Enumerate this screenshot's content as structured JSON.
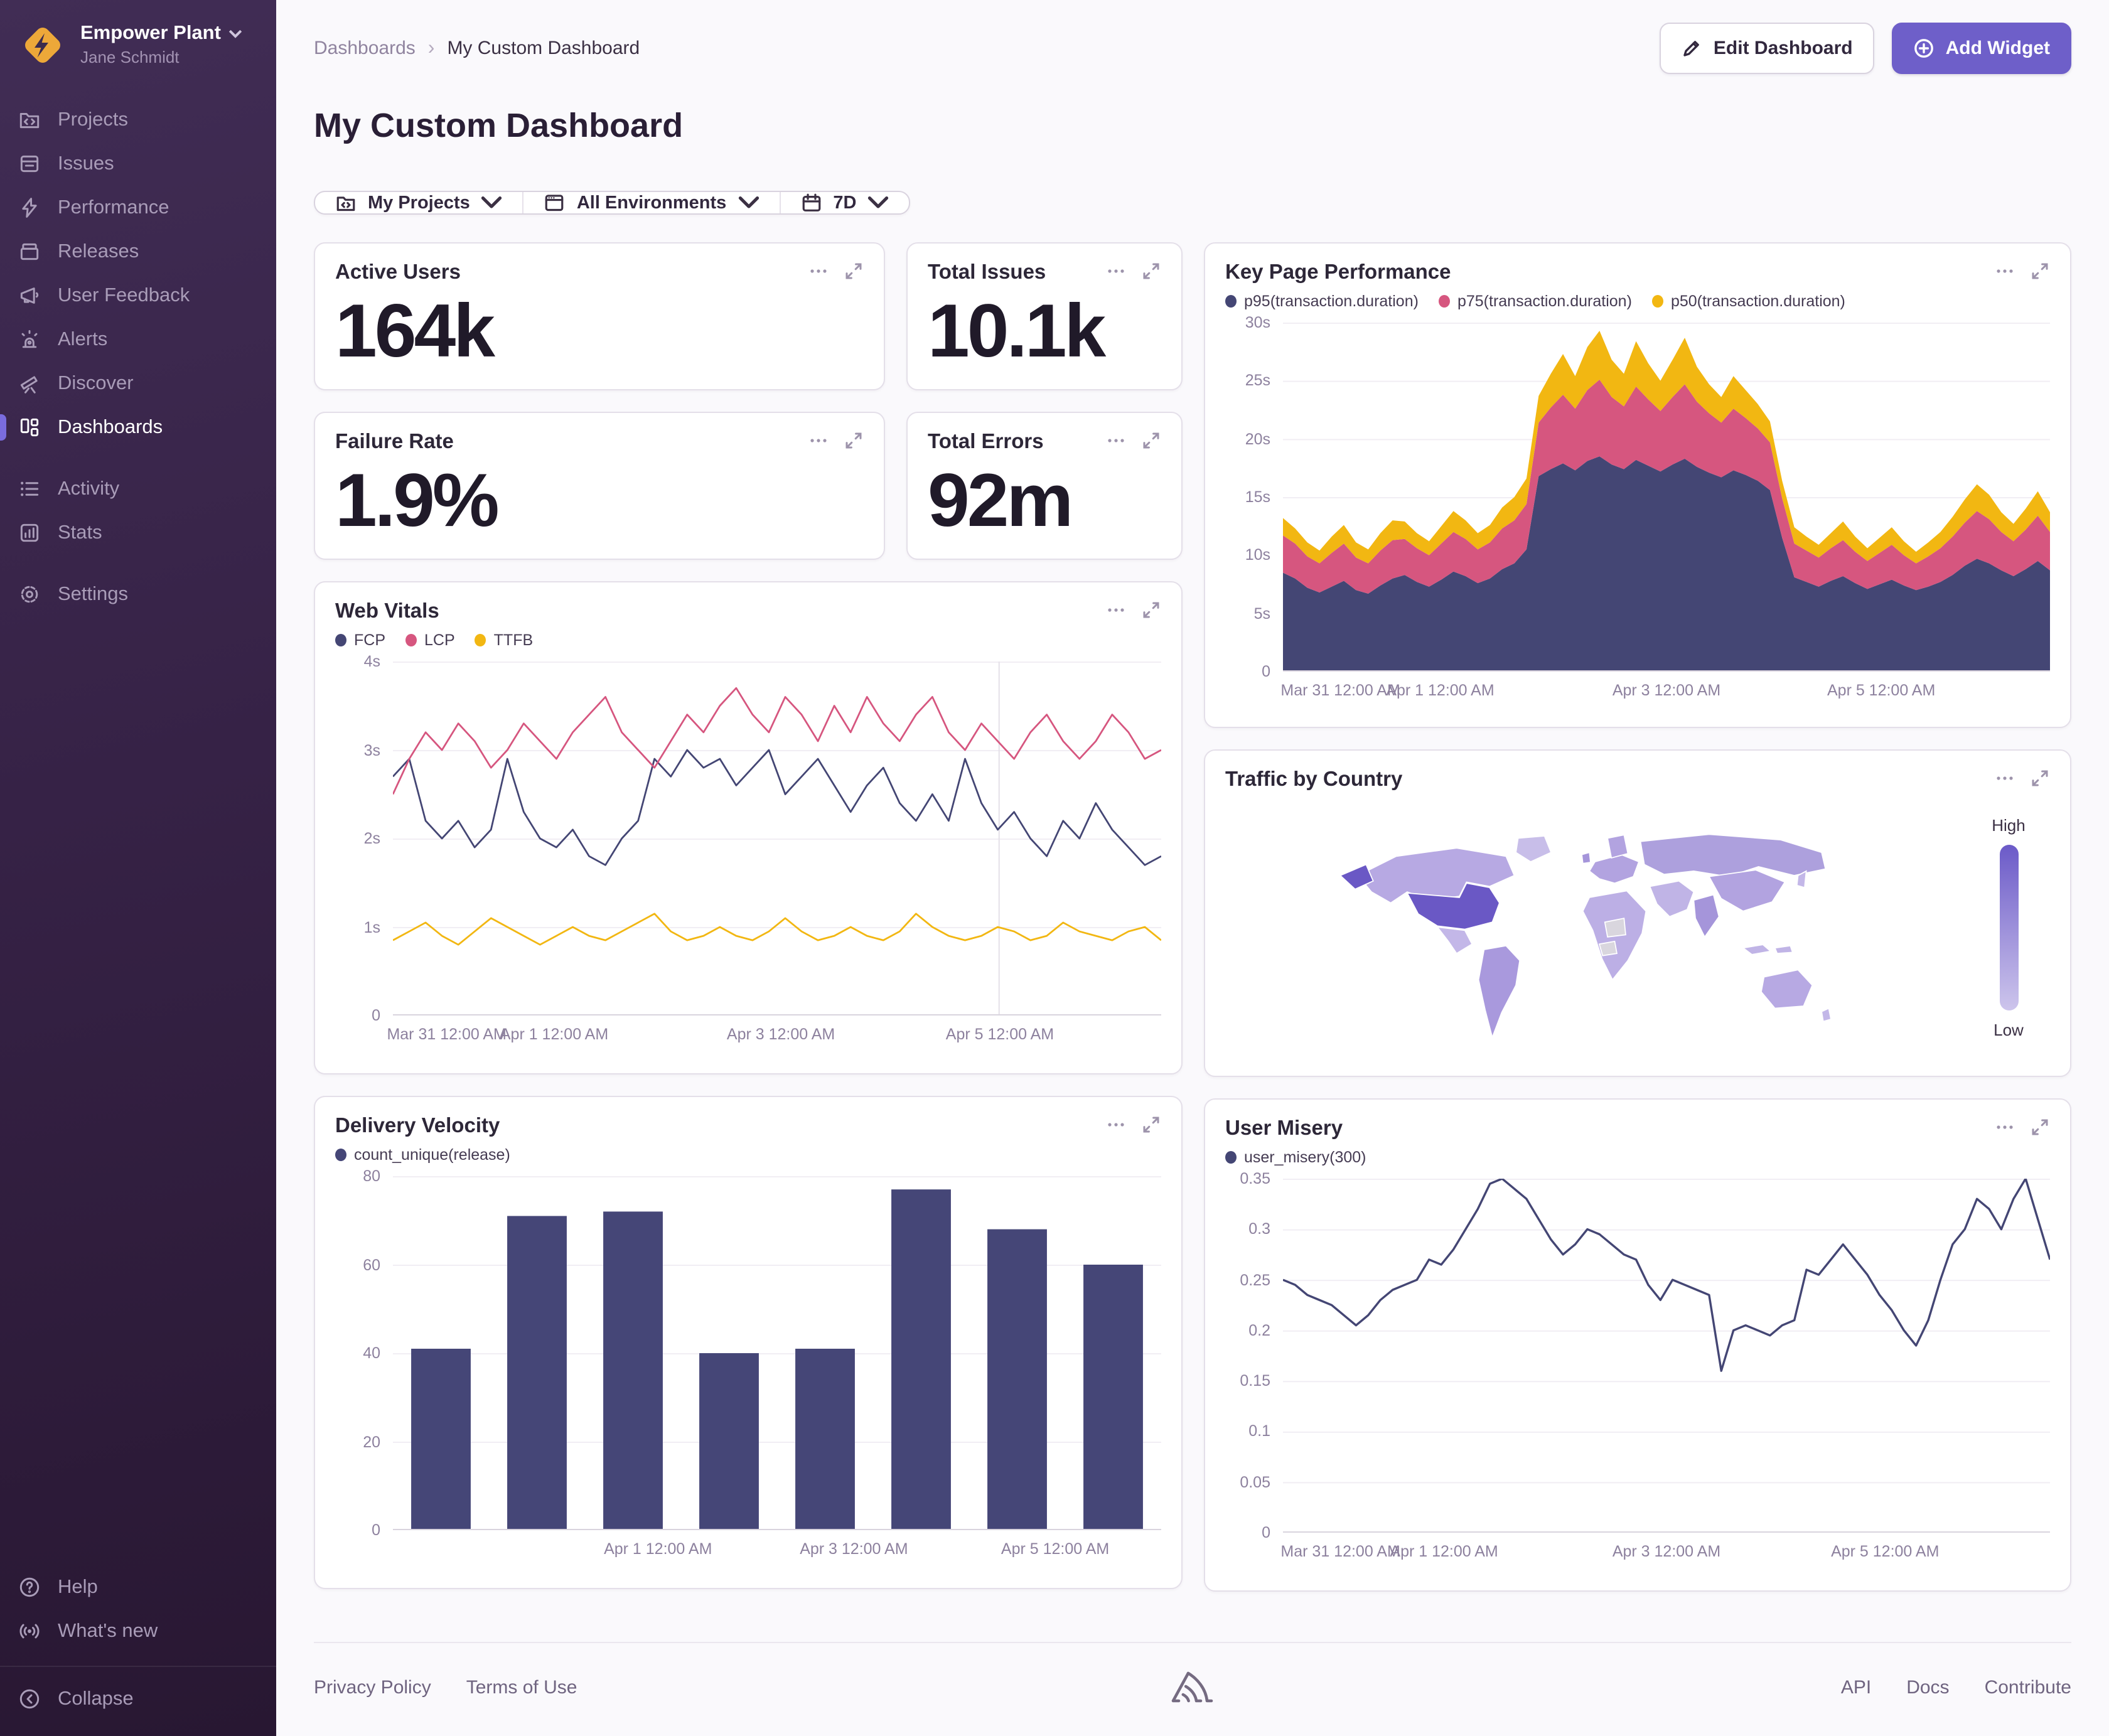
{
  "sidebar": {
    "org": {
      "name": "Empower Plant",
      "user": "Jane Schmidt"
    },
    "items": [
      {
        "label": "Projects"
      },
      {
        "label": "Issues"
      },
      {
        "label": "Performance"
      },
      {
        "label": "Releases"
      },
      {
        "label": "User Feedback"
      },
      {
        "label": "Alerts"
      },
      {
        "label": "Discover"
      },
      {
        "label": "Dashboards"
      },
      {
        "label": "Activity"
      },
      {
        "label": "Stats"
      },
      {
        "label": "Settings"
      }
    ],
    "active_item": "Dashboards",
    "bottom_items": [
      {
        "label": "Help"
      },
      {
        "label": "What's new"
      },
      {
        "label": "Collapse"
      }
    ]
  },
  "header": {
    "breadcrumb": {
      "parent": "Dashboards",
      "current": "My Custom Dashboard"
    },
    "title": "My Custom Dashboard",
    "edit_button": "Edit Dashboard",
    "add_button": "Add Widget"
  },
  "filters": {
    "projects": "My Projects",
    "environments": "All Environments",
    "date_range": "7D"
  },
  "big_numbers": [
    {
      "title": "Active Users",
      "value": "164k"
    },
    {
      "title": "Total Issues",
      "value": "10.1k"
    },
    {
      "title": "Failure Rate",
      "value": "1.9%"
    },
    {
      "title": "Total Errors",
      "value": "92m"
    }
  ],
  "map_widget": {
    "title": "Traffic by Country",
    "legend_high": "High",
    "legend_low": "Low",
    "note": "Choropleth world map; United States shaded darkest (high traffic), other countries light purple, a few countries gray (no data)"
  },
  "colors": {
    "accent": "#6e5fc9",
    "navy": "#444674",
    "pink": "#d6567f",
    "yellow": "#f2b712",
    "sidebar_active_indicator": "#7a6cde"
  },
  "footer": {
    "left": [
      "Privacy Policy",
      "Terms of Use"
    ],
    "right": [
      "API",
      "Docs",
      "Contribute"
    ]
  },
  "chart_data": [
    {
      "type": "area",
      "stacked": true,
      "title": "Key Page Performance",
      "ymax": 30,
      "yticks": [
        "0",
        "5s",
        "10s",
        "15s",
        "20s",
        "25s",
        "30s"
      ],
      "xticks": [
        {
          "label": "Mar 31 12:00 AM",
          "pos": 0.075
        },
        {
          "label": "Apr 1 12:00 AM",
          "pos": 0.205
        },
        {
          "label": "Apr 3 12:00 AM",
          "pos": 0.5
        },
        {
          "label": "Apr 5 12:00 AM",
          "pos": 0.78
        }
      ],
      "series": [
        {
          "name": "p95(transaction.duration)",
          "color": "#444674",
          "values": [
            8.5,
            8.0,
            7.2,
            6.8,
            7.3,
            7.8,
            7.0,
            6.7,
            7.4,
            8.0,
            8.3,
            7.7,
            7.3,
            7.9,
            8.6,
            8.2,
            7.6,
            8.0,
            8.8,
            9.3,
            10.5,
            16.8,
            17.4,
            17.9,
            17.3,
            18.1,
            18.5,
            17.8,
            17.4,
            18.2,
            17.7,
            17.2,
            17.8,
            18.3,
            17.6,
            17.1,
            16.7,
            17.3,
            16.9,
            16.4,
            15.6,
            11.5,
            8.1,
            7.7,
            7.3,
            7.8,
            8.2,
            7.6,
            7.1,
            7.5,
            7.9,
            7.4,
            7.0,
            7.3,
            7.7,
            8.3,
            9.1,
            9.7,
            9.3,
            8.7,
            8.2,
            8.8,
            9.5,
            8.7
          ]
        },
        {
          "name": "p75(transaction.duration)",
          "color": "#d6567f",
          "values": [
            3.2,
            3.0,
            2.7,
            2.5,
            2.9,
            3.2,
            2.8,
            2.6,
            3.0,
            3.3,
            3.1,
            2.9,
            2.7,
            3.1,
            3.4,
            3.2,
            2.9,
            3.1,
            3.5,
            3.7,
            3.9,
            4.6,
            5.3,
            5.9,
            5.3,
            6.1,
            6.6,
            5.8,
            5.4,
            6.3,
            5.7,
            5.2,
            5.8,
            6.4,
            5.6,
            5.1,
            4.7,
            5.3,
            4.9,
            4.5,
            4.1,
            3.4,
            2.9,
            2.7,
            2.5,
            2.8,
            3.1,
            2.7,
            2.4,
            2.7,
            3.0,
            2.6,
            2.3,
            2.6,
            2.9,
            3.3,
            3.7,
            4.1,
            3.8,
            3.3,
            3.0,
            3.4,
            3.9,
            3.3
          ]
        },
        {
          "name": "p50(transaction.duration)",
          "color": "#f2b712",
          "values": [
            1.5,
            1.3,
            1.2,
            1.1,
            1.4,
            1.6,
            1.3,
            1.2,
            1.5,
            1.7,
            1.5,
            1.3,
            1.2,
            1.5,
            1.8,
            1.6,
            1.4,
            1.5,
            1.8,
            2.0,
            2.2,
            2.3,
            2.9,
            3.5,
            2.8,
            3.7,
            4.2,
            3.2,
            2.8,
            3.9,
            3.1,
            2.6,
            3.2,
            4.0,
            3.0,
            2.5,
            2.2,
            2.8,
            2.4,
            2.1,
            1.8,
            1.5,
            1.4,
            1.2,
            1.1,
            1.3,
            1.6,
            1.3,
            1.1,
            1.3,
            1.5,
            1.2,
            1.0,
            1.2,
            1.4,
            1.7,
            2.0,
            2.3,
            2.1,
            1.7,
            1.5,
            1.8,
            2.1,
            1.7
          ]
        }
      ]
    },
    {
      "type": "line",
      "title": "Web Vitals",
      "ymax": 4,
      "yticks": [
        "0",
        "1s",
        "2s",
        "3s",
        "4s"
      ],
      "vline": 0.789,
      "xticks": [
        {
          "label": "Mar 31 12:00 AM",
          "pos": 0.07
        },
        {
          "label": "Apr 1 12:00 AM",
          "pos": 0.21
        },
        {
          "label": "Apr 3 12:00 AM",
          "pos": 0.505
        },
        {
          "label": "Apr 5 12:00 AM",
          "pos": 0.79
        }
      ],
      "series": [
        {
          "name": "FCP",
          "color": "#444674",
          "values": [
            2.7,
            2.9,
            2.2,
            2.0,
            2.2,
            1.9,
            2.1,
            2.9,
            2.3,
            2.0,
            1.9,
            2.1,
            1.8,
            1.7,
            2.0,
            2.2,
            2.9,
            2.7,
            3.0,
            2.8,
            2.9,
            2.6,
            2.8,
            3.0,
            2.5,
            2.7,
            2.9,
            2.6,
            2.3,
            2.6,
            2.8,
            2.4,
            2.2,
            2.5,
            2.2,
            2.9,
            2.4,
            2.1,
            2.3,
            2.0,
            1.8,
            2.2,
            2.0,
            2.4,
            2.1,
            1.9,
            1.7,
            1.8
          ]
        },
        {
          "name": "LCP",
          "color": "#d6567f",
          "values": [
            2.5,
            2.9,
            3.2,
            3.0,
            3.3,
            3.1,
            2.8,
            3.0,
            3.3,
            3.1,
            2.9,
            3.2,
            3.4,
            3.6,
            3.2,
            3.0,
            2.8,
            3.1,
            3.4,
            3.2,
            3.5,
            3.7,
            3.4,
            3.2,
            3.6,
            3.4,
            3.1,
            3.5,
            3.2,
            3.6,
            3.3,
            3.1,
            3.4,
            3.6,
            3.2,
            3.0,
            3.3,
            3.1,
            2.9,
            3.2,
            3.4,
            3.1,
            2.9,
            3.1,
            3.4,
            3.2,
            2.9,
            3.0
          ]
        },
        {
          "name": "TTFB",
          "color": "#f2b712",
          "values": [
            0.85,
            0.95,
            1.05,
            0.9,
            0.8,
            0.95,
            1.1,
            1.0,
            0.9,
            0.8,
            0.9,
            1.0,
            0.9,
            0.85,
            0.95,
            1.05,
            1.15,
            0.95,
            0.85,
            0.9,
            1.0,
            0.9,
            0.85,
            0.95,
            1.1,
            0.95,
            0.85,
            0.9,
            1.0,
            0.9,
            0.85,
            0.95,
            1.15,
            1.0,
            0.9,
            0.85,
            0.9,
            1.0,
            0.95,
            0.85,
            0.9,
            1.05,
            0.95,
            0.9,
            0.85,
            0.95,
            1.0,
            0.85
          ]
        }
      ]
    },
    {
      "type": "bar",
      "title": "Delivery Velocity",
      "ymax": 80,
      "yticks": [
        "0",
        "20",
        "40",
        "60",
        "80"
      ],
      "xticks": [
        {
          "label": "Apr 1 12:00 AM",
          "pos": 0.345
        },
        {
          "label": "Apr 3 12:00 AM",
          "pos": 0.6
        },
        {
          "label": "Apr 5 12:00 AM",
          "pos": 0.862
        }
      ],
      "series": [
        {
          "name": "count_unique(release)",
          "color": "#454677",
          "values": [
            41,
            71,
            72,
            40,
            41,
            77,
            68,
            60
          ]
        }
      ]
    },
    {
      "type": "line",
      "title": "User Misery",
      "ymax": 0.35,
      "lw": 1.7,
      "yticks": [
        "0",
        "0.05",
        "0.1",
        "0.15",
        "0.2",
        "0.25",
        "0.3",
        "0.35"
      ],
      "xticks": [
        {
          "label": "Mar 31 12:00 AM",
          "pos": 0.075
        },
        {
          "label": "Apr 1 12:00 AM",
          "pos": 0.21
        },
        {
          "label": "Apr 3 12:00 AM",
          "pos": 0.5
        },
        {
          "label": "Apr 5 12:00 AM",
          "pos": 0.785
        }
      ],
      "series": [
        {
          "name": "user_misery(300)",
          "color": "#444674",
          "values": [
            0.25,
            0.245,
            0.235,
            0.23,
            0.225,
            0.215,
            0.205,
            0.215,
            0.23,
            0.24,
            0.245,
            0.25,
            0.27,
            0.265,
            0.28,
            0.3,
            0.32,
            0.345,
            0.35,
            0.34,
            0.33,
            0.31,
            0.29,
            0.275,
            0.285,
            0.3,
            0.295,
            0.285,
            0.275,
            0.27,
            0.245,
            0.23,
            0.25,
            0.245,
            0.24,
            0.235,
            0.16,
            0.2,
            0.205,
            0.2,
            0.195,
            0.205,
            0.21,
            0.26,
            0.255,
            0.27,
            0.285,
            0.27,
            0.255,
            0.235,
            0.22,
            0.2,
            0.185,
            0.21,
            0.25,
            0.285,
            0.3,
            0.33,
            0.32,
            0.3,
            0.33,
            0.35,
            0.31,
            0.27
          ]
        }
      ]
    }
  ]
}
